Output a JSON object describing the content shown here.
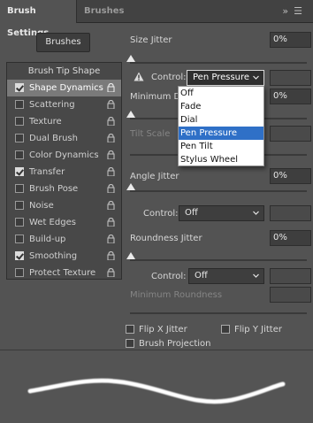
{
  "tabs": [
    {
      "label": "Brush Settings",
      "active": true
    },
    {
      "label": "Brushes",
      "active": false
    }
  ],
  "tabbar_icons": {
    "collapse": "double-chevron-right-icon",
    "menu": "hamburger-menu-icon"
  },
  "brushes_button": "Brushes",
  "sidebar": {
    "header": "Brush Tip Shape",
    "items": [
      {
        "label": "Shape Dynamics",
        "checked": true,
        "selected": true
      },
      {
        "label": "Scattering",
        "checked": false
      },
      {
        "label": "Texture",
        "checked": false
      },
      {
        "label": "Dual Brush",
        "checked": false
      },
      {
        "label": "Color Dynamics",
        "checked": false
      },
      {
        "label": "Transfer",
        "checked": true
      },
      {
        "label": "Brush Pose",
        "checked": false
      },
      {
        "label": "Noise",
        "checked": false
      },
      {
        "label": "Wet Edges",
        "checked": false
      },
      {
        "label": "Build-up",
        "checked": false
      },
      {
        "label": "Smoothing",
        "checked": true
      },
      {
        "label": "Protect Texture",
        "checked": false
      }
    ]
  },
  "size_jitter": {
    "label": "Size Jitter",
    "value": "0%"
  },
  "size_control": {
    "label": "Control:",
    "value": "Pen Pressure"
  },
  "minimum_diameter": {
    "label": "Minimum Di",
    "value": "0%"
  },
  "tilt_scale": {
    "label": "Tilt Scale"
  },
  "control_dropdown": {
    "options": [
      "Off",
      "Fade",
      "Dial",
      "Pen Pressure",
      "Pen Tilt",
      "Stylus Wheel"
    ],
    "highlighted": "Pen Pressure"
  },
  "angle_jitter": {
    "label": "Angle Jitter",
    "value": "0%"
  },
  "angle_control": {
    "label": "Control:",
    "value": "Off"
  },
  "roundness_jitter": {
    "label": "Roundness Jitter",
    "value": "0%"
  },
  "roundness_control": {
    "label": "Control:",
    "value": "Off"
  },
  "minimum_roundness": {
    "label": "Minimum Roundness"
  },
  "flip_x": {
    "label": "Flip X Jitter",
    "checked": false
  },
  "flip_y": {
    "label": "Flip Y Jitter",
    "checked": false
  },
  "brush_projection": {
    "label": "Brush Projection",
    "checked": false
  },
  "colors": {
    "panel": "#535353",
    "highlight": "#2f70c7",
    "selected_row": "#7a7a7a"
  }
}
